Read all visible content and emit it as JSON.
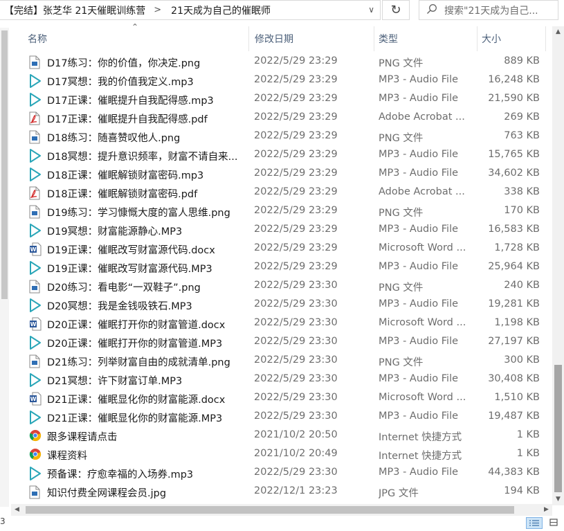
{
  "address": {
    "crumbs": [
      "【完结】张芝华 21天催眠训练营",
      "21天成为自己的催眠师"
    ],
    "search_placeholder": "搜索\"21天成为自己..."
  },
  "columns": {
    "name": "名称",
    "modified": "修改日期",
    "type": "类型",
    "size": "大小"
  },
  "files": [
    {
      "name": "D17练习：你的价值，你决定.png",
      "date": "2022/5/29 23:29",
      "type": "PNG 文件",
      "size": "889 KB",
      "icon": "png"
    },
    {
      "name": "D17冥想：我的价值我定义.mp3",
      "date": "2022/5/29 23:29",
      "type": "MP3 - Audio File",
      "size": "16,248 KB",
      "icon": "mp3"
    },
    {
      "name": "D17正课：催眠提升自我配得感.mp3",
      "date": "2022/5/29 23:29",
      "type": "MP3 - Audio File",
      "size": "21,590 KB",
      "icon": "mp3"
    },
    {
      "name": "D17正课：催眠提升自我配得感.pdf",
      "date": "2022/5/29 23:29",
      "type": "Adobe Acrobat ...",
      "size": "269 KB",
      "icon": "pdf"
    },
    {
      "name": "D18练习：随喜赞叹他人.png",
      "date": "2022/5/29 23:29",
      "type": "PNG 文件",
      "size": "763 KB",
      "icon": "png"
    },
    {
      "name": "D18冥想：提升意识频率，财富不请自来...",
      "date": "2022/5/29 23:29",
      "type": "MP3 - Audio File",
      "size": "15,765 KB",
      "icon": "mp3"
    },
    {
      "name": "D18正课：催眠解锁财富密码.mp3",
      "date": "2022/5/29 23:29",
      "type": "MP3 - Audio File",
      "size": "34,602 KB",
      "icon": "mp3"
    },
    {
      "name": "D18正课：催眠解锁财富密码.pdf",
      "date": "2022/5/29 23:29",
      "type": "Adobe Acrobat ...",
      "size": "338 KB",
      "icon": "pdf"
    },
    {
      "name": "D19练习：学习慷慨大度的富人思维.png",
      "date": "2022/5/29 23:29",
      "type": "PNG 文件",
      "size": "170 KB",
      "icon": "png"
    },
    {
      "name": "D19冥想：财富能源静心.MP3",
      "date": "2022/5/29 23:29",
      "type": "MP3 - Audio File",
      "size": "16,583 KB",
      "icon": "mp3"
    },
    {
      "name": "D19正课：催眠改写财富源代码.docx",
      "date": "2022/5/29 23:29",
      "type": "Microsoft Word ...",
      "size": "1,728 KB",
      "icon": "docx"
    },
    {
      "name": "D19正课：催眠改写财富源代码.MP3",
      "date": "2022/5/29 23:29",
      "type": "MP3 - Audio File",
      "size": "25,964 KB",
      "icon": "mp3"
    },
    {
      "name": "D20练习：看电影“一双鞋子”.png",
      "date": "2022/5/29 23:30",
      "type": "PNG 文件",
      "size": "240 KB",
      "icon": "png"
    },
    {
      "name": "D20冥想：我是金钱吸铁石.MP3",
      "date": "2022/5/29 23:30",
      "type": "MP3 - Audio File",
      "size": "19,281 KB",
      "icon": "mp3"
    },
    {
      "name": "D20正课：催眠打开你的财富管道.docx",
      "date": "2022/5/29 23:30",
      "type": "Microsoft Word ...",
      "size": "1,198 KB",
      "icon": "docx"
    },
    {
      "name": "D20正课：催眠打开你的财富管道.MP3",
      "date": "2022/5/29 23:30",
      "type": "MP3 - Audio File",
      "size": "27,197 KB",
      "icon": "mp3"
    },
    {
      "name": "D21练习：列举财富自由的成就清单.png",
      "date": "2022/5/29 23:30",
      "type": "PNG 文件",
      "size": "300 KB",
      "icon": "png"
    },
    {
      "name": "D21冥想：许下财富订单.MP3",
      "date": "2022/5/29 23:30",
      "type": "MP3 - Audio File",
      "size": "30,408 KB",
      "icon": "mp3"
    },
    {
      "name": "D21正课：催眠显化你的财富能源.docx",
      "date": "2022/5/29 23:30",
      "type": "Microsoft Word ...",
      "size": "1,510 KB",
      "icon": "docx"
    },
    {
      "name": "D21正课：催眠显化你的财富能源.MP3",
      "date": "2022/5/29 23:30",
      "type": "MP3 - Audio File",
      "size": "19,487 KB",
      "icon": "mp3"
    },
    {
      "name": "跟多课程请点击",
      "date": "2021/10/2 20:50",
      "type": "Internet 快捷方式",
      "size": "1 KB",
      "icon": "chrome"
    },
    {
      "name": "课程资料",
      "date": "2021/10/2 20:49",
      "type": "Internet 快捷方式",
      "size": "1 KB",
      "icon": "chrome"
    },
    {
      "name": "预备课：疗愈幸福的入场券.mp3",
      "date": "2022/5/29 23:30",
      "type": "MP3 - Audio File",
      "size": "44,383 KB",
      "icon": "mp3"
    },
    {
      "name": "知识付费全网课程会员.jpg",
      "date": "2022/12/1 23:23",
      "type": "JPG 文件",
      "size": "194 KB",
      "icon": "png"
    }
  ],
  "status": {
    "left_text": "3"
  }
}
